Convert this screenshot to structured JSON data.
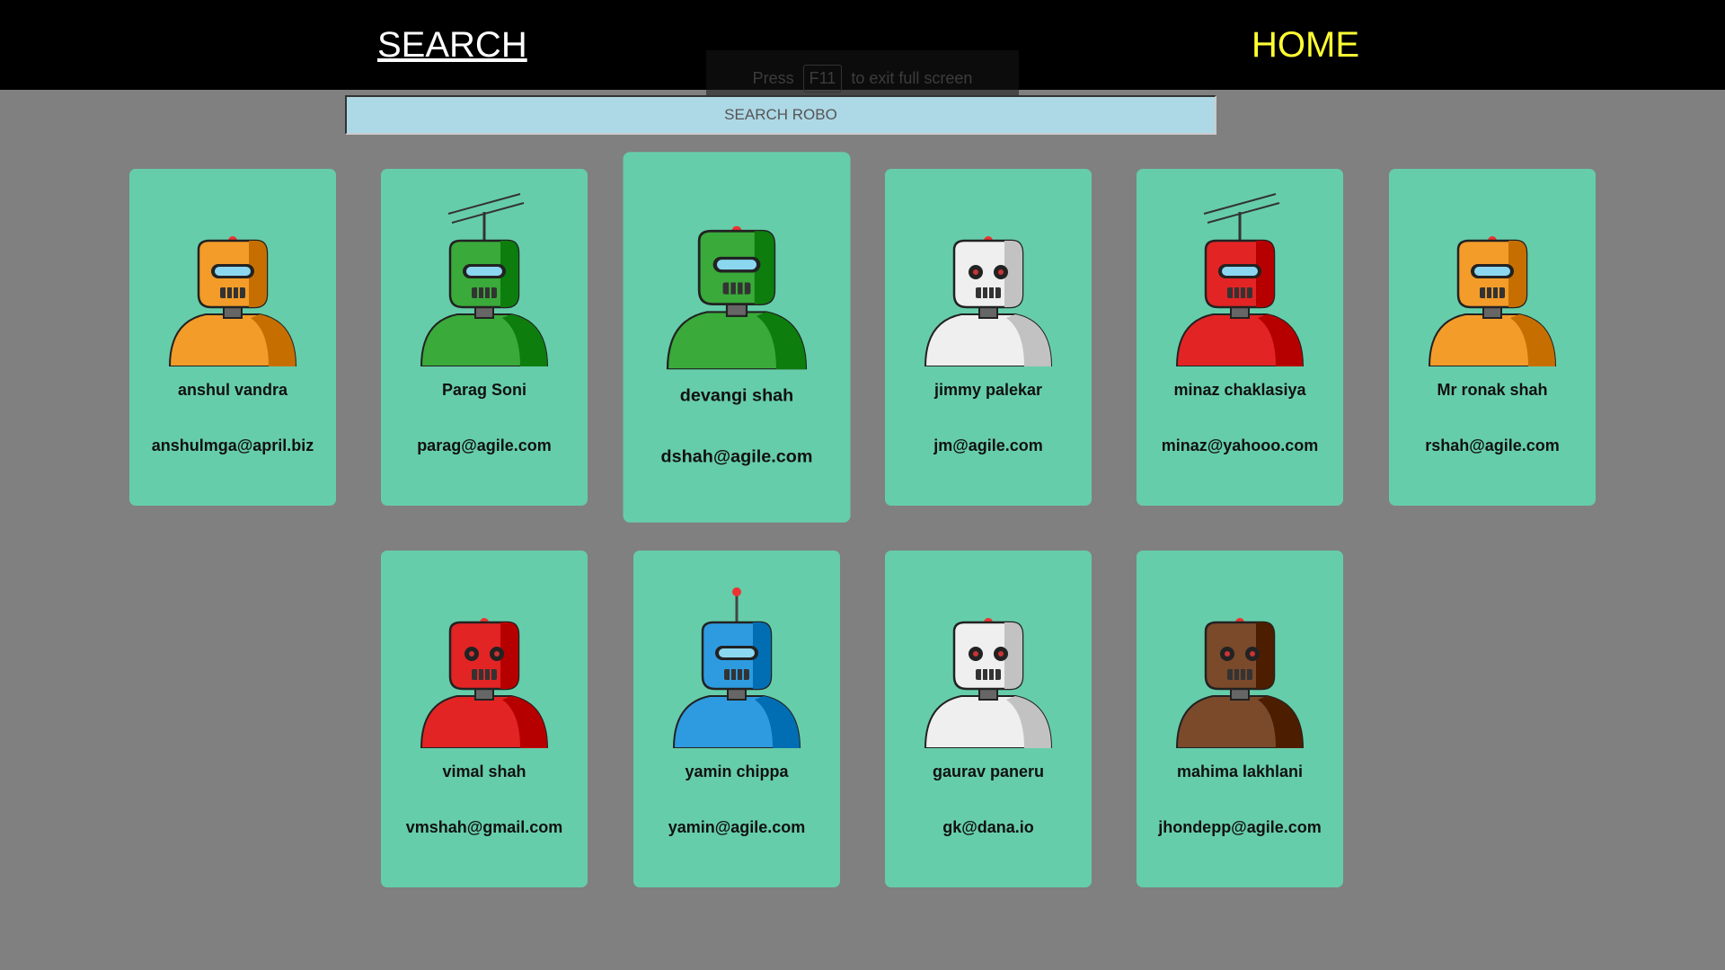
{
  "nav": {
    "search_label": "SEARCH",
    "home_label": "HOME",
    "home_color": "#ffff33"
  },
  "fullscreen_notice": {
    "before": "Press",
    "key": "F11",
    "after": "to exit full screen"
  },
  "search": {
    "placeholder": "SEARCH ROBO"
  },
  "colors": {
    "page_bg": "#808080",
    "card_bg": "#66cdaa",
    "search_bg": "#add8e6"
  },
  "robots": [
    {
      "name": "anshul vandra",
      "email": "anshulmga@april.biz",
      "color": "#f39c2a",
      "icon": "orange-robot-icon"
    },
    {
      "name": "Parag Soni",
      "email": "parag@agile.com",
      "color": "#3aaa3a",
      "icon": "green-antenna-robot-icon"
    },
    {
      "name": "devangi shah",
      "email": "dshah@agile.com",
      "color": "#3aaa3a",
      "icon": "green-robot-icon"
    },
    {
      "name": "jimmy palekar",
      "email": "jm@agile.com",
      "color": "#efefef",
      "icon": "white-robot-icon"
    },
    {
      "name": "minaz chaklasiya",
      "email": "minaz@yahooo.com",
      "color": "#e32424",
      "icon": "red-antenna-robot-icon"
    },
    {
      "name": "Mr ronak shah",
      "email": "rshah@agile.com",
      "color": "#f39c2a",
      "icon": "orange-shield-robot-icon"
    },
    {
      "name": "vimal shah",
      "email": "vmshah@gmail.com",
      "color": "#e32424",
      "icon": "red-can-robot-icon"
    },
    {
      "name": "yamin chippa",
      "email": "yamin@agile.com",
      "color": "#2e9be0",
      "icon": "blue-robot-icon"
    },
    {
      "name": "gaurav paneru",
      "email": "gk@dana.io",
      "color": "#efefef",
      "icon": "white-small-robot-icon"
    },
    {
      "name": "mahima lakhlani",
      "email": "jhondepp@agile.com",
      "color": "#7a4a2a",
      "icon": "brown-robot-icon"
    }
  ]
}
